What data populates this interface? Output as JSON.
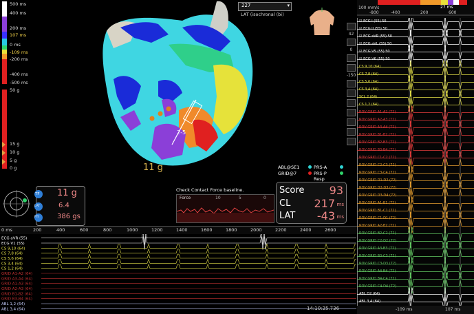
{
  "sidebar": {
    "ms_labels": [
      "500 ms",
      "400 ms",
      "200 ms",
      "107 ms",
      "0 ms",
      "-109 ms",
      "-200 ms",
      "-400 ms",
      "-500 ms"
    ],
    "g_labels": [
      "50 g",
      "15 g",
      "10 g",
      "5 g",
      "0 g"
    ]
  },
  "map": {
    "dropdown_value": "227",
    "map_name": "LAT (isochronal (bi)",
    "force_label": "11 g",
    "catheter_tag": "2-5"
  },
  "rtools": {
    "labels": [
      "42",
      "0",
      "-150"
    ]
  },
  "sensor": {
    "row1_left": "ABL@SE1",
    "row1_right": "PRS-A",
    "row2_left": "GRID@7",
    "row2_right": "PRS-P",
    "row3_right": "Resp"
  },
  "score": {
    "score_label": "Score",
    "score_value": "93",
    "cl_label": "CL",
    "cl_value": "217",
    "cl_unit": "ms",
    "lat_label": "LAT",
    "lat_value": "-43",
    "lat_unit": "ms"
  },
  "contact": {
    "title": "Check Contact Force baseline.",
    "plot_label": "Force",
    "ticks": [
      "10",
      "5",
      "0"
    ]
  },
  "force_box": {
    "tf_badge": "TF",
    "tf_value": "11 g",
    "lat_badge": "LAT",
    "lat_value": "6.4",
    "fti_badge": "FTI",
    "fti_value": "386 gs"
  },
  "bottom_ruler": {
    "start": "0 ms",
    "ticks": [
      "200",
      "400",
      "600",
      "800",
      "1000",
      "1200",
      "1400",
      "1600",
      "1800",
      "2000",
      "2200",
      "2400",
      "2600"
    ]
  },
  "bottom_channels": [
    "ECG aVR (55)",
    "ECG V1 (55)",
    "CS 9,10 (64)",
    "CS 7,8 (64)",
    "CS 5,6 (64)",
    "CS 3,4 (64)",
    "CS 1,2 (64)",
    "GRID A1-A2 (64)",
    "GRID A3-A4 (64)",
    "GRID A1-A3 (64)",
    "GRID A2-A3 (64)",
    "GRID B1-B2 (64)",
    "GRID B3-B4 (64)",
    "ABL 1,2 (64)",
    "ABL 3,4 (64)"
  ],
  "timestamp": "14:10:25.736",
  "right_panel": {
    "speed": "100 mm/s",
    "ruler_ticks": [
      "-800",
      "-400",
      "200",
      "600"
    ],
    "lat_marker": "27 ms",
    "channels": [
      {
        "name": "ECG I (55) 50",
        "color": "#ffffff",
        "checked": true
      },
      {
        "name": "ECG II (55) 50",
        "color": "#ffffff",
        "checked": true
      },
      {
        "name": "ECG aVR (55) 50",
        "color": "#ffffff",
        "checked": true
      },
      {
        "name": "ECG aVL (55) 50",
        "color": "#ffffff",
        "checked": true
      },
      {
        "name": "ECG V5 (55) 50",
        "color": "#ffffff",
        "checked": true
      },
      {
        "name": "ECG V6 (55) 50",
        "color": "#ffffff",
        "checked": true
      },
      {
        "name": "CS 9,10 (64)",
        "color": "#e6e24a",
        "checked": false
      },
      {
        "name": "CS 7,8 (64)",
        "color": "#e6e24a",
        "checked": false
      },
      {
        "name": "CS 5,6 (64)",
        "color": "#e6e24a",
        "checked": false
      },
      {
        "name": "CS 3,4 (64)",
        "color": "#e6e24a",
        "checked": false
      },
      {
        "name": "SCL 2 (64)",
        "color": "#e6e24a",
        "checked": false
      },
      {
        "name": "CS 1,2 (64)",
        "color": "#e6e24a",
        "checked": false
      },
      {
        "name": "ROV GRID A1-A2 (72)",
        "color": "#e43c3c",
        "checked": false
      },
      {
        "name": "ROV GRID A2-A3 (72)",
        "color": "#e43c3c",
        "checked": false
      },
      {
        "name": "ROV GRID A3-A4 (72)",
        "color": "#e43c3c",
        "checked": false
      },
      {
        "name": "ROV GRID B1-B2 (72)",
        "color": "#e43c3c",
        "checked": false
      },
      {
        "name": "ROV GRID B2-B3 (72)",
        "color": "#e43c3c",
        "checked": false
      },
      {
        "name": "ROV GRID B3-B4 (72)",
        "color": "#e43c3c",
        "checked": false
      },
      {
        "name": "ROV GRID C1-C2 (72)",
        "color": "#e43c3c",
        "checked": false
      },
      {
        "name": "ROV GRID C2-C3 (72)",
        "color": "#e8a030",
        "checked": false
      },
      {
        "name": "ROV GRID C3-C4 (72)",
        "color": "#e8a030",
        "checked": false
      },
      {
        "name": "ROV GRID D1-D2 (72)",
        "color": "#e8a030",
        "checked": false
      },
      {
        "name": "ROV GRID D2-D3 (72)",
        "color": "#e8a030",
        "checked": false
      },
      {
        "name": "ROV GRID D3-D4 (72)",
        "color": "#e8a030",
        "checked": false
      },
      {
        "name": "ROV GRID A1-B1 (72)",
        "color": "#e8a030",
        "checked": false
      },
      {
        "name": "ROV GRID B1-C1 (72)",
        "color": "#e8a030",
        "checked": false
      },
      {
        "name": "ROV GRID C1-D1 (72)",
        "color": "#e8a030",
        "checked": false
      },
      {
        "name": "ROV GRID A2-B2 (72)",
        "color": "#e8a030",
        "checked": false
      },
      {
        "name": "ROV GRID B2-C2 (72)",
        "color": "#66cc66",
        "checked": false
      },
      {
        "name": "ROV GRID C2-D2 (72)",
        "color": "#66cc66",
        "checked": false
      },
      {
        "name": "ROV GRID A3-B3 (72)",
        "color": "#66cc66",
        "checked": false
      },
      {
        "name": "ROV GRID B3-C3 (72)",
        "color": "#66cc66",
        "checked": false
      },
      {
        "name": "ROV GRID C3-D3 (72)",
        "color": "#66cc66",
        "checked": false
      },
      {
        "name": "ROV GRID A4-B4 (72)",
        "color": "#66cc66",
        "checked": false
      },
      {
        "name": "ROV GRID B4-C4 (72)",
        "color": "#66cc66",
        "checked": false
      },
      {
        "name": "ROV GRID C4-D4 (72)",
        "color": "#66cc66",
        "checked": false
      },
      {
        "name": "ABL D2 (64)",
        "color": "#ffffff",
        "checked": false
      },
      {
        "name": "ABL 3,4 (64)",
        "color": "#ffffff",
        "checked": false
      }
    ],
    "footer_left": "-109 ms",
    "footer_right": "107 ms"
  },
  "colors": {
    "ms_bar": [
      "#ffffff",
      "#8b3fd8",
      "#2040ff",
      "#27c9e0",
      "#2fd36a",
      "#e8e03a",
      "#f19a2a",
      "#e02020"
    ],
    "force_bar": [
      "#e03030",
      "#e0a040"
    ],
    "score_value": "#e88888"
  }
}
